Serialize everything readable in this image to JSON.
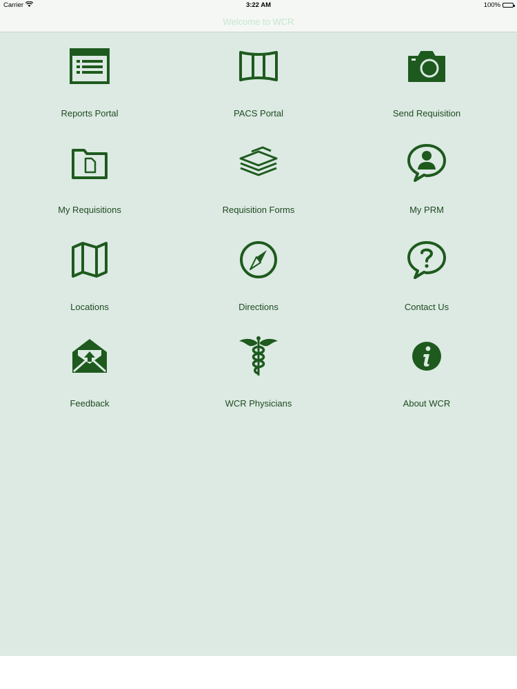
{
  "status_bar": {
    "carrier": "Carrier",
    "time": "3:22 AM",
    "battery": "100%"
  },
  "nav": {
    "title": "Welcome to WCR"
  },
  "colors": {
    "icon_green": "#1e5a1e",
    "label_green": "#1f4a21",
    "background": "#dceae3"
  },
  "menu": [
    {
      "label": "Reports Portal",
      "icon": "reports-icon"
    },
    {
      "label": "PACS Portal",
      "icon": "pacs-icon"
    },
    {
      "label": "Send Requisition",
      "icon": "camera-icon"
    },
    {
      "label": "My Requisitions",
      "icon": "folder-icon"
    },
    {
      "label": "Requisition Forms",
      "icon": "forms-stack-icon"
    },
    {
      "label": "My PRM",
      "icon": "person-chat-icon"
    },
    {
      "label": "Locations",
      "icon": "map-icon"
    },
    {
      "label": "Directions",
      "icon": "compass-icon"
    },
    {
      "label": "Contact Us",
      "icon": "question-chat-icon"
    },
    {
      "label": "Feedback",
      "icon": "mail-icon"
    },
    {
      "label": "WCR Physicians",
      "icon": "caduceus-icon"
    },
    {
      "label": "About WCR",
      "icon": "info-icon"
    }
  ]
}
